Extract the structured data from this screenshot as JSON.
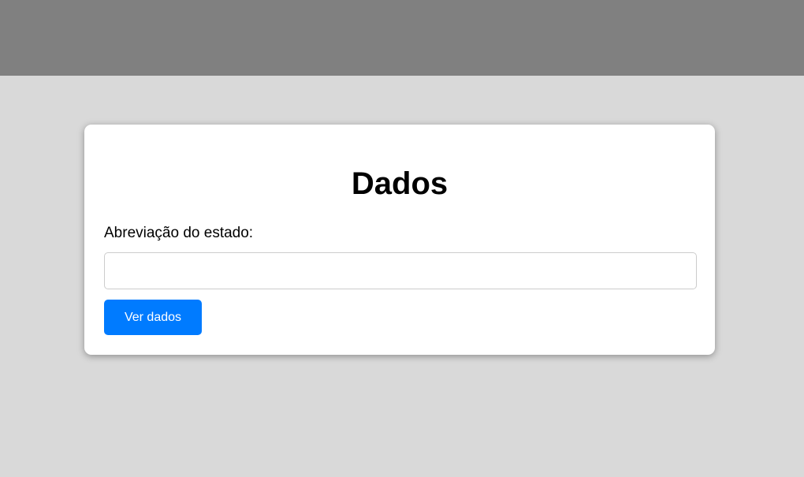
{
  "form": {
    "title": "Dados",
    "field_label": "Abreviação do estado:",
    "input_value": "",
    "input_placeholder": "",
    "button_label": "Ver dados"
  },
  "colors": {
    "header_bar": "#808080",
    "page_background": "#d9d9d9",
    "card_background": "#ffffff",
    "button_background": "#007bff",
    "button_text": "#ffffff"
  }
}
